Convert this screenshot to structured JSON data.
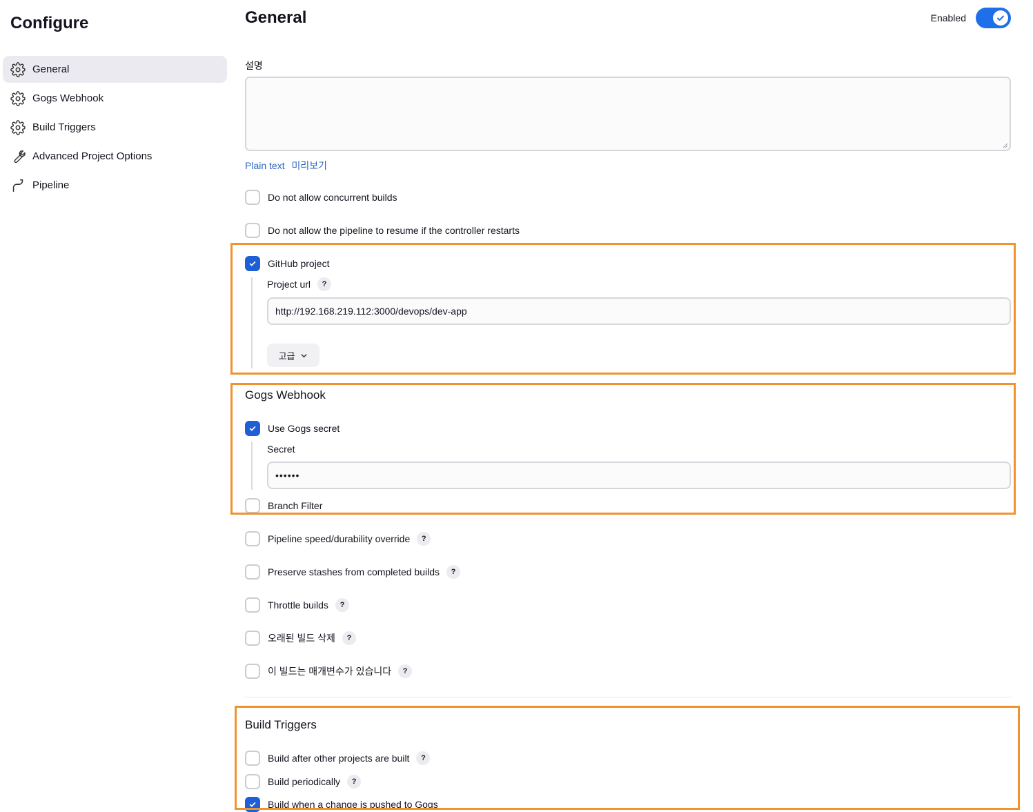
{
  "page": {
    "title": "Configure"
  },
  "sidebar": {
    "items": [
      {
        "label": "General",
        "icon": "gear-icon",
        "active": true
      },
      {
        "label": "Gogs Webhook",
        "icon": "gear-icon"
      },
      {
        "label": "Build Triggers",
        "icon": "gear-icon"
      },
      {
        "label": "Advanced Project Options",
        "icon": "wrench-icon"
      },
      {
        "label": "Pipeline",
        "icon": "pipeline-icon"
      }
    ]
  },
  "general": {
    "title": "General",
    "enabled_label": "Enabled",
    "enabled": true,
    "description_label": "설명",
    "description_value": "",
    "plain_text_link": "Plain text",
    "preview_link": "미리보기",
    "options": {
      "no_concurrent": {
        "label": "Do not allow concurrent builds",
        "checked": false
      },
      "no_resume": {
        "label": "Do not allow the pipeline to resume if the controller restarts",
        "checked": false
      },
      "github_project": {
        "label": "GitHub project",
        "checked": true
      }
    },
    "project_url_label": "Project url",
    "project_url_value": "http://192.168.219.112:3000/devops/dev-app",
    "advanced_button": "고급"
  },
  "gogs": {
    "title": "Gogs Webhook",
    "use_secret": {
      "label": "Use Gogs secret",
      "checked": true
    },
    "secret_label": "Secret",
    "secret_value": "••••••",
    "branch_filter": {
      "label": "Branch Filter",
      "checked": false
    }
  },
  "more_options": [
    {
      "label": "Pipeline speed/durability override",
      "checked": false
    },
    {
      "label": "Preserve stashes from completed builds",
      "checked": false
    },
    {
      "label": "Throttle builds",
      "checked": false
    },
    {
      "label": "오래된 빌드 삭제",
      "checked": false
    },
    {
      "label": "이 빌드는 매개변수가 있습니다",
      "checked": false
    }
  ],
  "build_triggers": {
    "title": "Build Triggers",
    "options": [
      {
        "label": "Build after other projects are built",
        "checked": false
      },
      {
        "label": "Build periodically",
        "checked": false
      },
      {
        "label": "Build when a change is pushed to Gogs",
        "checked": true
      }
    ]
  },
  "help_glyph": "?",
  "colors": {
    "accent": "#1f5fd6",
    "toggle": "#1f6feb",
    "highlight": "#f0922e",
    "link": "#2f66c4",
    "sidebar_active_bg": "#eaeaf0"
  }
}
